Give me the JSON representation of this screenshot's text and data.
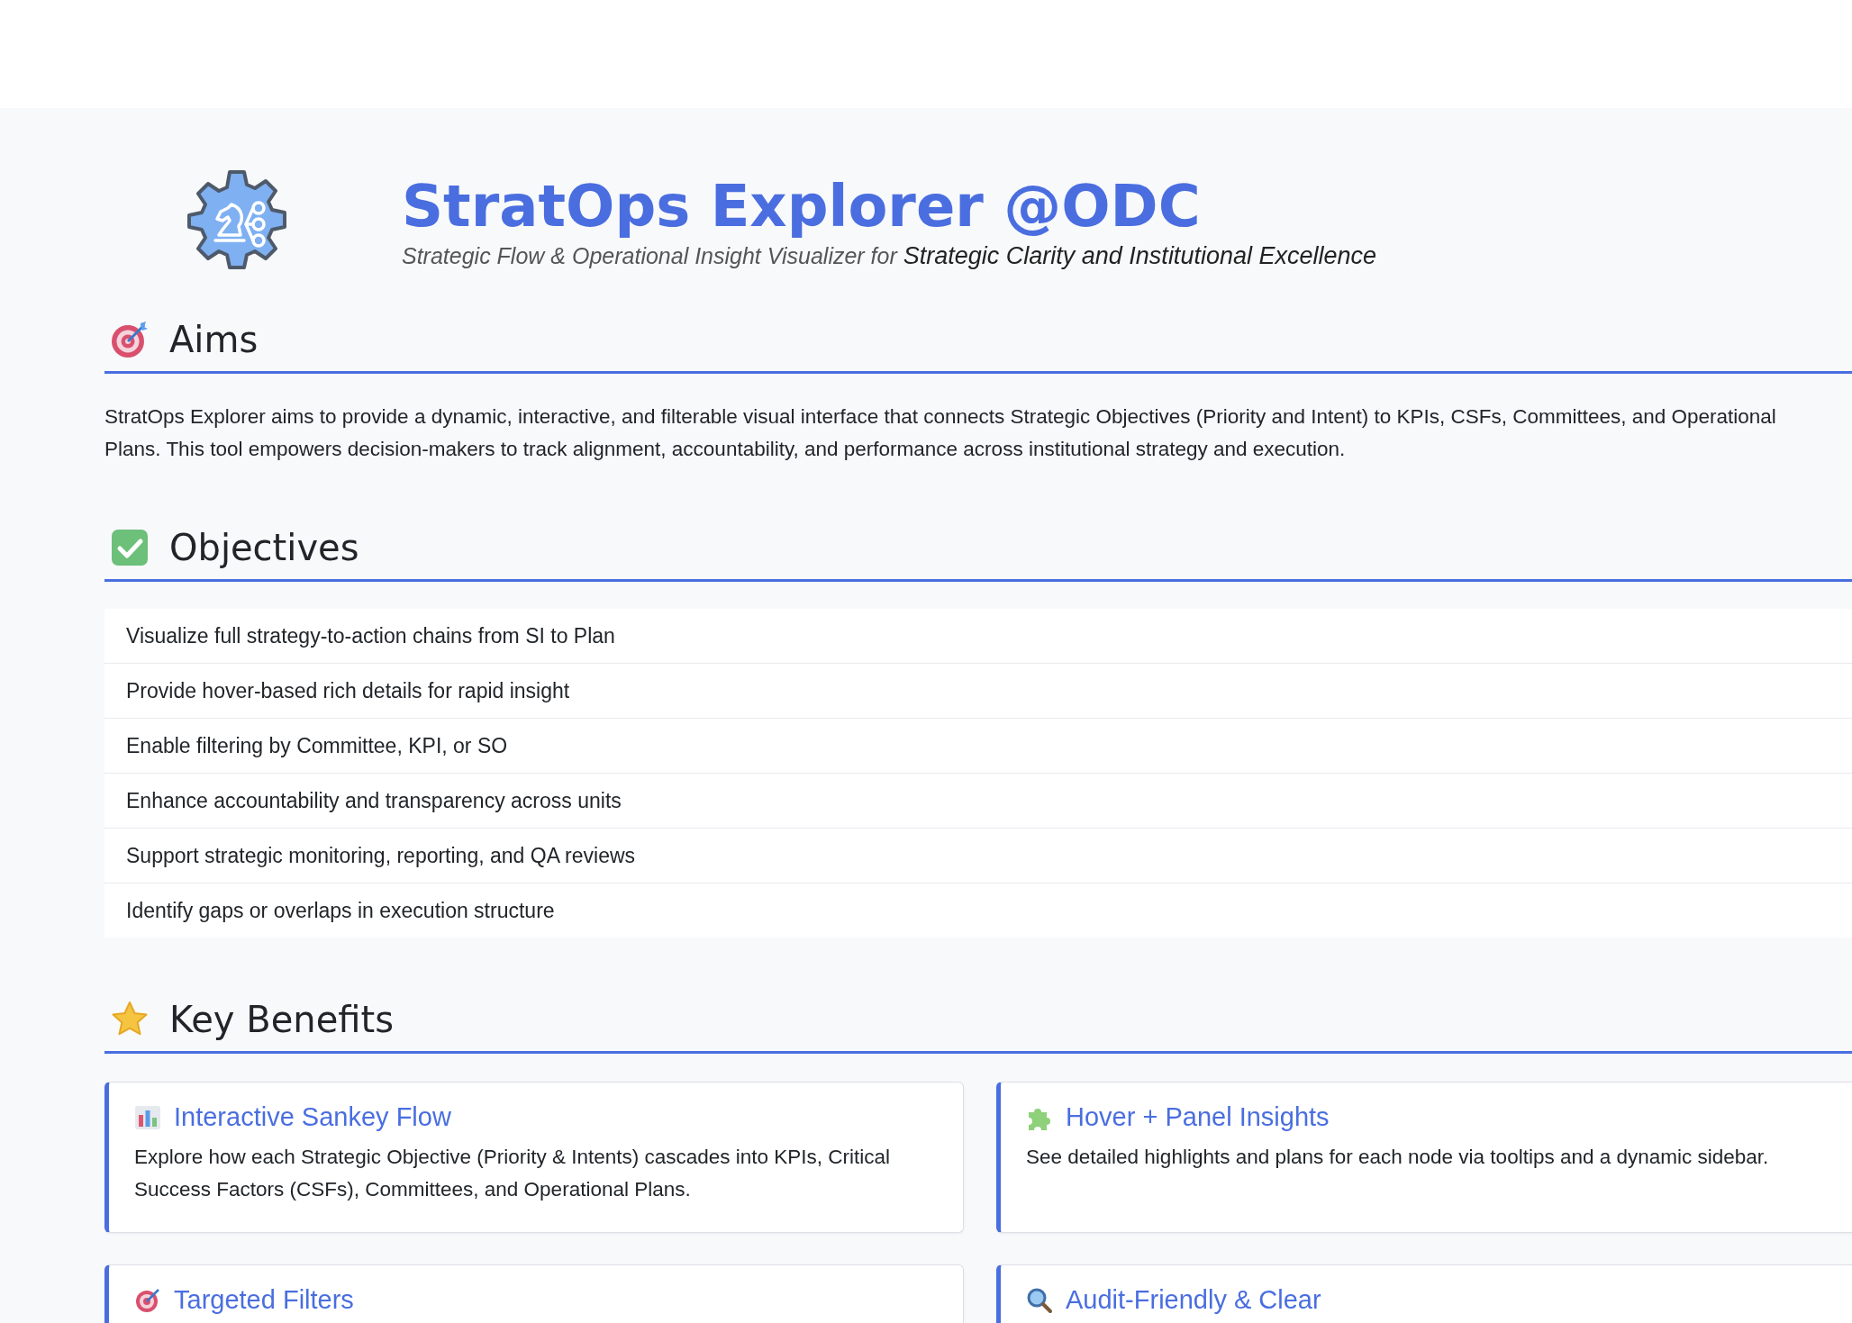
{
  "header": {
    "title": "StratOps Explorer @ODC",
    "subtitle": "Strategic Flow & Operational Insight Visualizer for **Strategic Clarity and Institutional Excellence**"
  },
  "aims": {
    "heading": "Aims",
    "text": "StratOps Explorer aims to provide a dynamic, interactive, and filterable visual interface that connects Strategic Objectives (Priority and Intent) to KPIs, CSFs, Committees, and Operational Plans. This tool empowers decision-makers to track alignment, accountability, and performance across institutional strategy and execution."
  },
  "objectives": {
    "heading": "Objectives",
    "items": [
      "Visualize full strategy-to-action chains from SI to Plan",
      "Provide hover-based rich details for rapid insight",
      "Enable filtering by Committee, KPI, or SO",
      "Enhance accountability and transparency across units",
      "Support strategic monitoring, reporting, and QA reviews",
      "Identify gaps or overlaps in execution structure"
    ]
  },
  "benefits": {
    "heading": "Key Benefits",
    "cards": [
      {
        "title": "Interactive Sankey Flow",
        "text": "Explore how each Strategic Objective (Priority & Intents) cascades into KPIs, Critical Success Factors (CSFs), Committees, and Operational Plans."
      },
      {
        "title": "Hover + Panel Insights",
        "text": "See detailed highlights and plans for each node via tooltips and a dynamic sidebar."
      },
      {
        "title": "Targeted Filters"
      },
      {
        "title": "Audit-Friendly & Clear"
      }
    ]
  }
}
